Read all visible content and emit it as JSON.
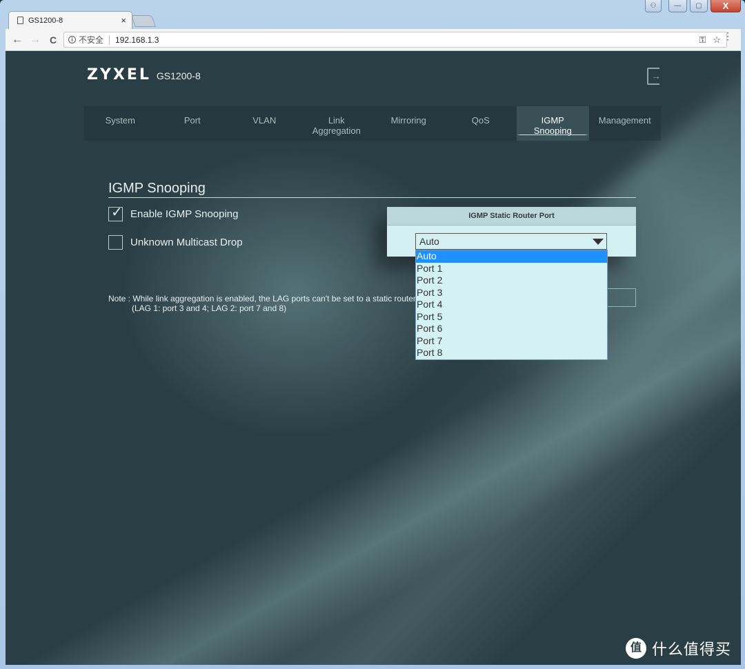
{
  "browser": {
    "tab_title": "GS1200-8",
    "tab_close": "×",
    "security_label": "不安全",
    "url": "192.168.1.3",
    "icons": {
      "back": "←",
      "forward": "→",
      "reload": "C",
      "info": "i",
      "key": "⚿",
      "star": "☆",
      "menu": "⋮"
    },
    "window_controls": {
      "user": "⚇",
      "minimize": "—",
      "maximize": "▢",
      "close": "X"
    }
  },
  "header": {
    "brand": "ZYXEL",
    "model": "GS1200-8",
    "logout_icon": "→"
  },
  "nav": {
    "items": [
      {
        "label": "System"
      },
      {
        "label": "Port"
      },
      {
        "label": "VLAN"
      },
      {
        "label": "Link\nAggregation"
      },
      {
        "label": "Mirroring"
      },
      {
        "label": "QoS"
      },
      {
        "label": "IGMP\nSnooping",
        "active": true
      },
      {
        "label": "Management"
      }
    ]
  },
  "content": {
    "title": "IGMP Snooping",
    "enable_igmp": {
      "label": "Enable IGMP Snooping",
      "checked": true,
      "checkmark": "✓"
    },
    "unknown_multicast_drop": {
      "label": "Unknown Multicast Drop",
      "checked": false
    },
    "router_port": {
      "header": "IGMP Static Router Port",
      "selected": "Auto",
      "options": [
        "Auto",
        "Port 1",
        "Port 2",
        "Port 3",
        "Port 4",
        "Port 5",
        "Port 6",
        "Port 7",
        "Port 8"
      ]
    },
    "note_line1": "Note : While link aggregation is enabled, the LAG ports can't be set to a static router port.",
    "note_line2": "(LAG 1: port 3 and 4; LAG 2: port 7 and 8)"
  },
  "watermark": {
    "icon": "值",
    "text": "什么值得买"
  },
  "colors": {
    "page_bg": "#2a3e45",
    "panel_bg": "#d4eff1",
    "selected_option": "#1e90ff"
  }
}
